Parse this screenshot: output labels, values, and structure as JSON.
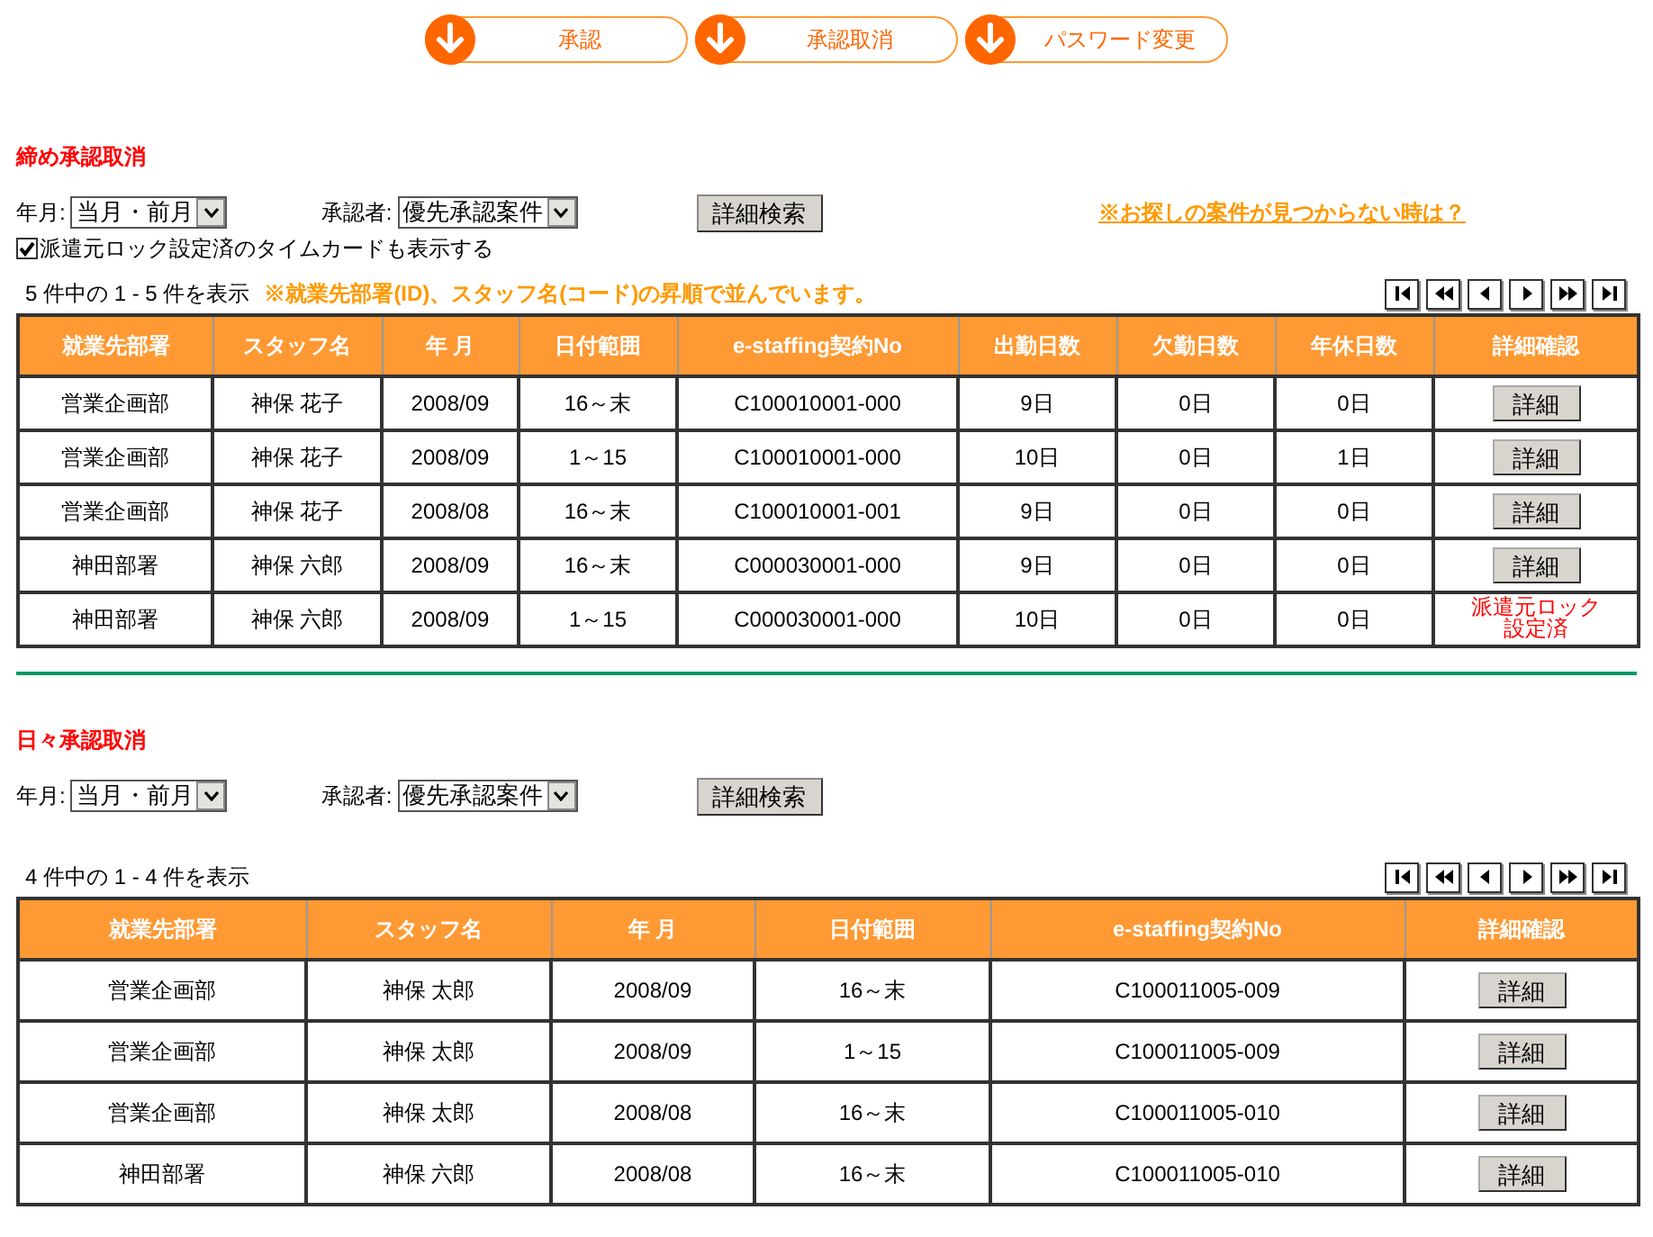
{
  "nav_buttons": [
    {
      "label": "承認"
    },
    {
      "label": "承認取消"
    },
    {
      "label": "パスワード変更"
    }
  ],
  "sections": [
    {
      "title": "締め承認取消",
      "filters": {
        "year_month_label": "年月:",
        "year_month_value": "当月・前月",
        "approver_label": "承認者:",
        "approver_value": "優先承認案件",
        "search_button": "詳細検索",
        "help_link": "※お探しの案件が見つからない時は？",
        "show_locked": {
          "label": "派遣元ロック設定済のタイムカードも表示する",
          "checked": true
        }
      },
      "count": "5 件中の 1 - 5 件を表示",
      "sort_note": "※就業先部署(ID)、スタッフ名(コード)の昇順で並んでいます。",
      "table": {
        "columns": [
          "就業先部署",
          "スタッフ名",
          "年 月",
          "日付範囲",
          "e-staffing契約No",
          "出勤日数",
          "欠勤日数",
          "年休日数",
          "詳細確認"
        ],
        "rows": [
          {
            "cells": [
              "営業企画部",
              "神保 花子",
              "2008/09",
              "16～末",
              "C100010001-000",
              "9日",
              "0日",
              "0日"
            ],
            "action": {
              "kind": "button",
              "label": "詳細"
            }
          },
          {
            "cells": [
              "営業企画部",
              "神保 花子",
              "2008/09",
              "1～15",
              "C100010001-000",
              "10日",
              "0日",
              "1日"
            ],
            "action": {
              "kind": "button",
              "label": "詳細"
            }
          },
          {
            "cells": [
              "営業企画部",
              "神保 花子",
              "2008/08",
              "16～末",
              "C100010001-001",
              "9日",
              "0日",
              "0日"
            ],
            "action": {
              "kind": "button",
              "label": "詳細"
            }
          },
          {
            "cells": [
              "神田部署",
              "神保 六郎",
              "2008/09",
              "16～末",
              "C000030001-000",
              "9日",
              "0日",
              "0日"
            ],
            "action": {
              "kind": "button",
              "label": "詳細"
            }
          },
          {
            "cells": [
              "神田部署",
              "神保 六郎",
              "2008/09",
              "1～15",
              "C000030001-000",
              "10日",
              "0日",
              "0日"
            ],
            "action": {
              "kind": "locked",
              "label": "派遣元ロック設定済"
            }
          }
        ]
      }
    },
    {
      "title": "日々承認取消",
      "filters": {
        "year_month_label": "年月:",
        "year_month_value": "当月・前月",
        "approver_label": "承認者:",
        "approver_value": "優先承認案件",
        "search_button": "詳細検索"
      },
      "count": "4 件中の 1 - 4 件を表示",
      "table": {
        "columns": [
          "就業先部署",
          "スタッフ名",
          "年 月",
          "日付範囲",
          "e-staffing契約No",
          "詳細確認"
        ],
        "rows": [
          {
            "cells": [
              "営業企画部",
              "神保 太郎",
              "2008/09",
              "16～末",
              "C100011005-009"
            ],
            "action": {
              "kind": "button",
              "label": "詳細"
            }
          },
          {
            "cells": [
              "営業企画部",
              "神保 太郎",
              "2008/09",
              "1～15",
              "C100011005-009"
            ],
            "action": {
              "kind": "button",
              "label": "詳細"
            }
          },
          {
            "cells": [
              "営業企画部",
              "神保 太郎",
              "2008/08",
              "16～末",
              "C100011005-010"
            ],
            "action": {
              "kind": "button",
              "label": "詳細"
            }
          },
          {
            "cells": [
              "神田部署",
              "神保 六郎",
              "2008/08",
              "16～末",
              "C100011005-010"
            ],
            "action": {
              "kind": "button",
              "label": "詳細"
            }
          }
        ]
      }
    }
  ]
}
